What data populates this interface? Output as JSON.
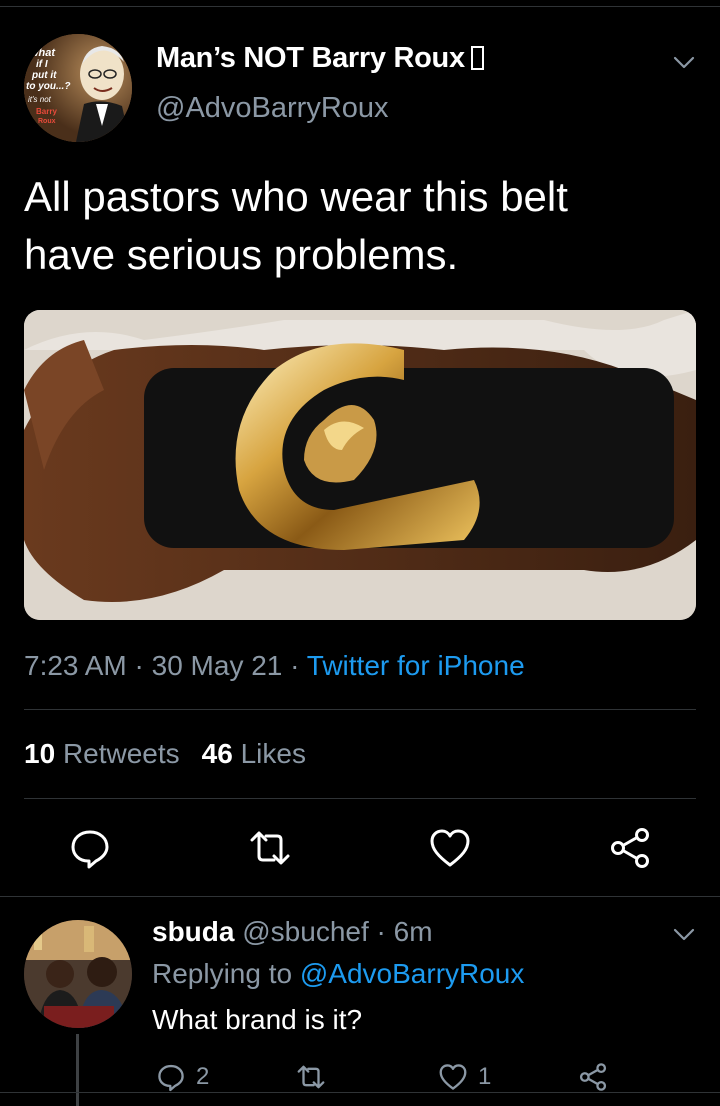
{
  "tweet": {
    "avatar_icon": "cartoon-portrait-avatar",
    "avatar_caption": [
      "what",
      "if I",
      "put it",
      "to you...?",
      "it's not",
      "Barry",
      "Roux"
    ],
    "display_name": "Man’s NOT Barry Roux",
    "handle": "@AdvoBarryRoux",
    "text_line1": "All pastors who wear this belt",
    "text_line2": "have serious problems.",
    "media_icon": "gold-eagle-belt-buckle-photo",
    "time": "7:23 AM",
    "date": "30 May 21",
    "separator": " · ",
    "source": "Twitter for iPhone",
    "retweets_count": "10",
    "retweets_label": "Retweets",
    "likes_count": "46",
    "likes_label": "Likes"
  },
  "actions": {
    "reply_icon": "reply-icon",
    "retweet_icon": "retweet-icon",
    "like_icon": "heart-icon",
    "share_icon": "share-icon"
  },
  "reply": {
    "avatar_icon": "group-photo-avatar",
    "display_name": "sbuda",
    "handle": "@sbuchef",
    "time": "6m",
    "separator": " · ",
    "replying_to_label": "Replying to",
    "replying_to_handle": "@AdvoBarryRoux",
    "text": "What brand is it?",
    "reply_count": "2",
    "like_count": "1"
  },
  "colors": {
    "background": "#000000",
    "accent": "#1d9bf0",
    "secondary_text": "#8b98a5",
    "divider": "#2f3336"
  }
}
